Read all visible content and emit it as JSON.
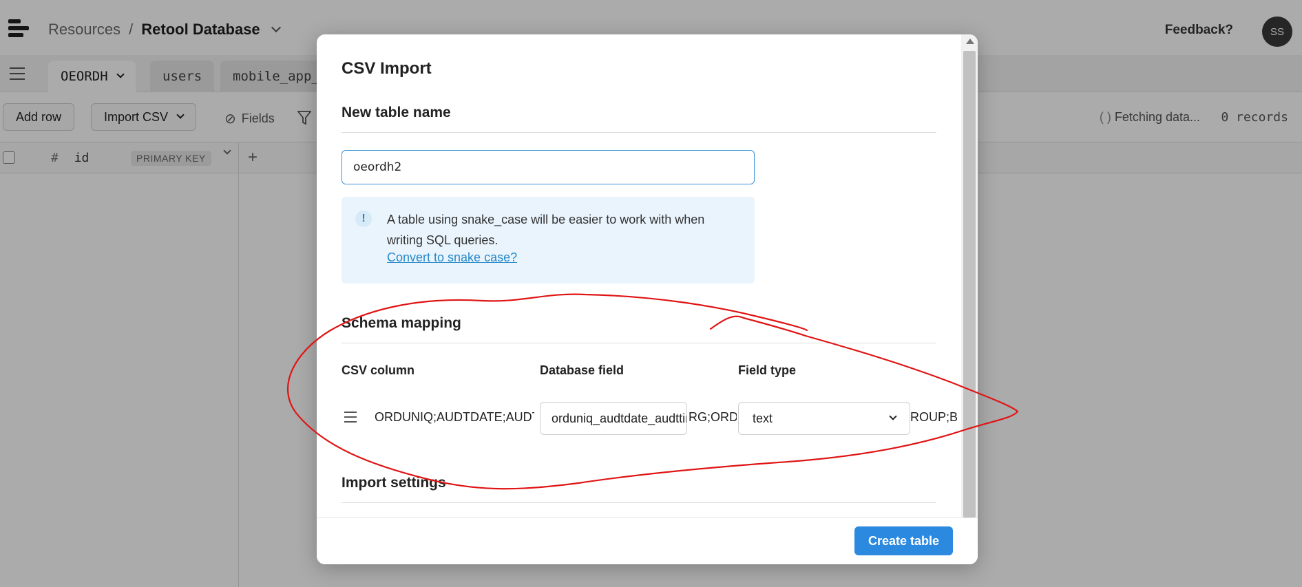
{
  "app": {
    "breadcrumb": {
      "parent": "Resources",
      "separator": "/",
      "current": "Retool Database"
    },
    "feedback": "Feedback?",
    "avatar_initials": "SS",
    "tabs": [
      {
        "label": "OEORDH",
        "active": true
      },
      {
        "label": "users",
        "active": false
      },
      {
        "label": "mobile_app_",
        "active": false
      }
    ],
    "toolbar": {
      "add_row": "Add row",
      "import_csv": "Import CSV",
      "fields": "Fields",
      "status": "Fetching data...",
      "records": "0 records"
    },
    "grid": {
      "column_name": "id",
      "column_icon": "#",
      "column_badge": "PRIMARY KEY",
      "add_column": "+"
    }
  },
  "modal": {
    "title": "CSV Import",
    "new_table_section": "New table name",
    "table_name_value": "oeordh2",
    "info": {
      "icon": "!",
      "message": "A table using snake_case will be easier to work with when writing SQL queries.",
      "link": "Convert to snake case?"
    },
    "schema_section": "Schema mapping",
    "headers": {
      "csv_column": "CSV column",
      "database_field": "Database field",
      "field_type": "Field type"
    },
    "row": {
      "csv_column": "ORDUNIQ;AUDTDATE;AUDTTIME;AUDTUSER;AUDTORG;ORDNUMBER;CUSTOMER;CUSTGROUP;BILNAME",
      "database_field": "orduniq_audtdate_audttime_audtuser_audtorg",
      "overflow_mid": "RG;ORDN",
      "field_type": "text",
      "overflow_right": "ROUP;BIL"
    },
    "import_section": "Import settings",
    "create_button": "Create table"
  },
  "colors": {
    "accent": "#2b8ae0",
    "info_bg": "#e9f4fc",
    "annotation": "#e01414"
  }
}
